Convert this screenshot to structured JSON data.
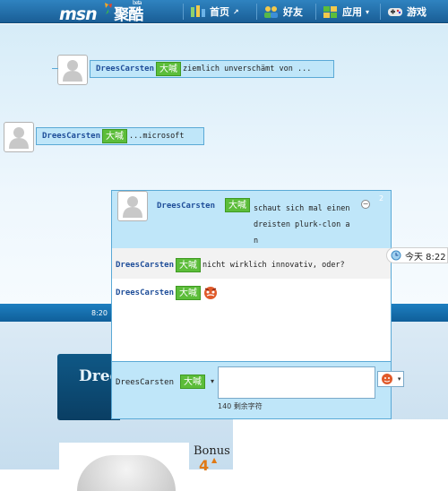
{
  "nav": {
    "logo_text": "msn",
    "logo_suffix": "聚酷",
    "beta": "beta",
    "items": [
      {
        "label": "首页",
        "icon": "home-icon",
        "suffix": "↗"
      },
      {
        "label": "好友",
        "icon": "friends-icon"
      },
      {
        "label": "应用",
        "icon": "apps-icon",
        "suffix": "▾"
      },
      {
        "label": "游戏",
        "icon": "gamepad-icon"
      }
    ]
  },
  "posts": [
    {
      "user": "DreesCarsten",
      "tag": "大喊",
      "text": "ziemlich unverschämt von  ..."
    },
    {
      "user": "DreesCarsten",
      "tag": "大喊",
      "text": "...microsoft"
    }
  ],
  "chat": {
    "header_user": "DreesCarsten",
    "header_tag": "大喊",
    "header_text_lines": [
      "schaut sich mal einen",
      "dreisten plurk-clon a",
      "n"
    ],
    "collapse_symbol": "−",
    "reply_count": "2",
    "messages": [
      {
        "user": "DreesCarsten",
        "tag": "大喊",
        "text": "nicht wirklich innovativ, oder?"
      },
      {
        "user": "DreesCarsten",
        "tag": "大喊",
        "text": ""
      }
    ],
    "compose": {
      "user": "DreesCarsten",
      "tag": "大喊",
      "tag_arrow": "▾",
      "placeholder": "",
      "chars_left": "140 剩余字符",
      "emoticon_arrow": "▾"
    }
  },
  "today_label": "今天 8:22",
  "band_time": "8:20",
  "background": {
    "dark_text": "Dree",
    "bonus_label": "Bonus",
    "bonus_value": "4"
  },
  "colors": {
    "nav": "#1f6ea8",
    "bubble": "#bfe6f9",
    "bubble_border": "#5aa9d6",
    "tag": "#5cbd3a",
    "username": "#1f4e99"
  }
}
